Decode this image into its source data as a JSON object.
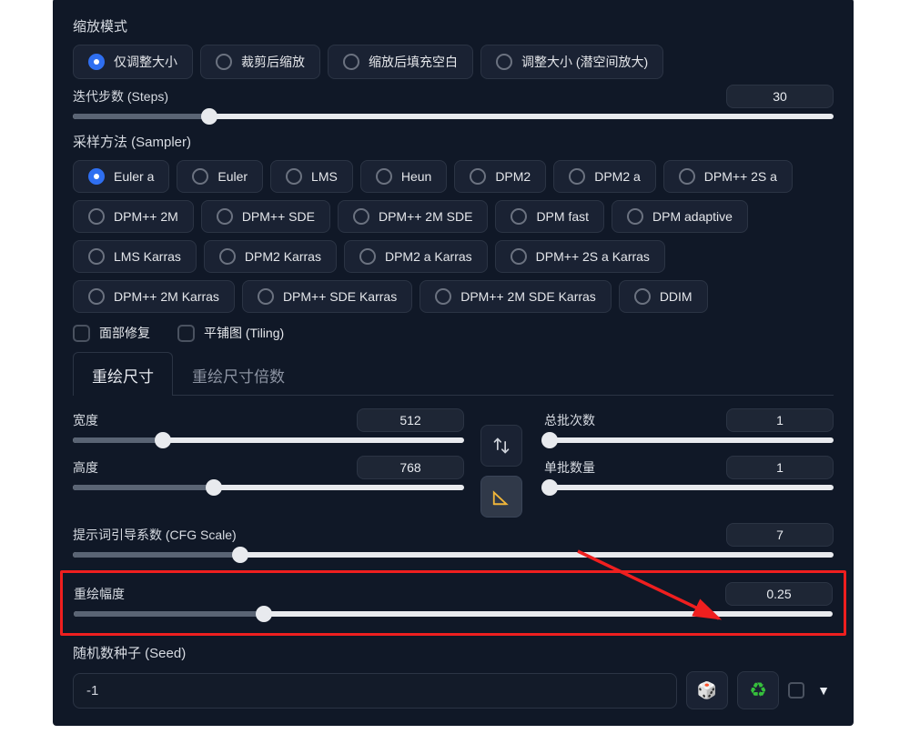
{
  "resize": {
    "label": "缩放模式",
    "options": [
      "仅调整大小",
      "裁剪后缩放",
      "缩放后填充空白",
      "调整大小 (潜空间放大)"
    ],
    "selected": 0
  },
  "steps": {
    "label": "迭代步数 (Steps)",
    "value": 30,
    "min": 1,
    "max": 150,
    "fill_pct": 18
  },
  "sampler": {
    "label": "采样方法 (Sampler)",
    "options": [
      "Euler a",
      "Euler",
      "LMS",
      "Heun",
      "DPM2",
      "DPM2 a",
      "DPM++ 2S a",
      "DPM++ 2M",
      "DPM++ SDE",
      "DPM++ 2M SDE",
      "DPM fast",
      "DPM adaptive",
      "LMS Karras",
      "DPM2 Karras",
      "DPM2 a Karras",
      "DPM++ 2S a Karras",
      "DPM++ 2M Karras",
      "DPM++ SDE Karras",
      "DPM++ 2M SDE Karras",
      "DDIM"
    ],
    "selected": 0
  },
  "checks": {
    "face": "面部修复",
    "tiling": "平铺图 (Tiling)"
  },
  "tabs": {
    "resize_abs": "重绘尺寸",
    "resize_mult": "重绘尺寸倍数",
    "active": 0
  },
  "width": {
    "label": "宽度",
    "value": 512,
    "fill_pct": 23
  },
  "height": {
    "label": "高度",
    "value": 768,
    "fill_pct": 36
  },
  "swap_btn": "swap",
  "ruler_btn": "ruler",
  "batch_count": {
    "label": "总批次数",
    "value": 1,
    "fill_pct": 2
  },
  "batch_size": {
    "label": "单批数量",
    "value": 1,
    "fill_pct": 2
  },
  "cfg": {
    "label": "提示词引导系数 (CFG Scale)",
    "value": 7,
    "fill_pct": 22
  },
  "denoise": {
    "label": "重绘幅度",
    "value": 0.25,
    "fill_pct": 25
  },
  "seed": {
    "label": "随机数种子 (Seed)",
    "value": "-1",
    "dice": "🎲",
    "recycle": "♻"
  }
}
